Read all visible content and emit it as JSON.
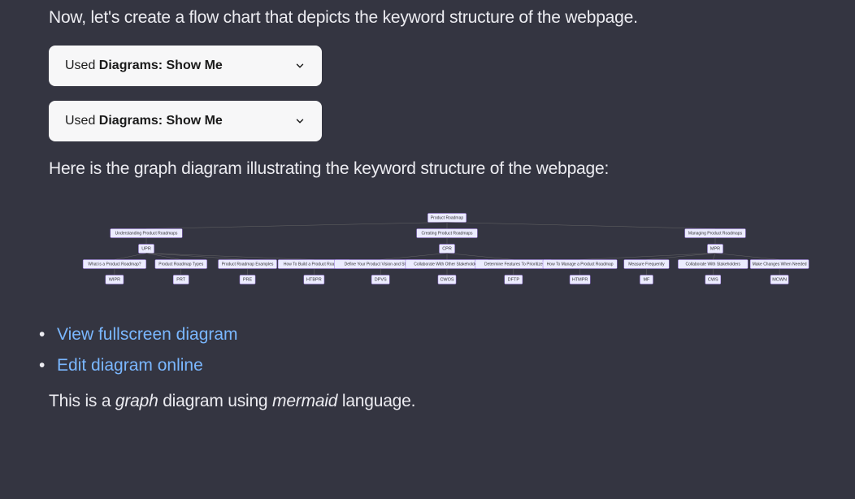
{
  "intro": "Now, let's create a flow chart that depicts the keyword structure of the webpage.",
  "accordion": {
    "prefix": "Used ",
    "bold": "Diagrams: Show Me"
  },
  "result": "Here is the graph diagram illustrating the keyword structure of the webpage:",
  "links": {
    "fullscreen": "View fullscreen diagram",
    "edit": "Edit diagram online"
  },
  "footer": {
    "p1": "This is a ",
    "em1": "graph",
    "p2": " diagram using ",
    "em2": "mermaid",
    "p3": " language."
  },
  "diagram": {
    "root": "Product Roadmap",
    "groups": [
      {
        "title": "Understanding Product Roadmaps",
        "code": "UPR"
      },
      {
        "title": "Creating Product Roadmaps",
        "code": "CPR"
      },
      {
        "title": "Managing Product Roadmaps",
        "code": "MPR"
      }
    ],
    "leaves": [
      {
        "title": "What is a Product Roadmap?",
        "code": "WIPR",
        "group": 0
      },
      {
        "title": "Product Roadmap Types",
        "code": "PRT",
        "group": 0
      },
      {
        "title": "Product Roadmap Examples",
        "code": "PRE",
        "group": 0
      },
      {
        "title": "How To Build a Product Roadmap",
        "code": "HTBPR",
        "group": 0
      },
      {
        "title": "Define Your Product Vision and Strategy",
        "code": "DPVS",
        "group": 1
      },
      {
        "title": "Collaborate With Other Stakeholders",
        "code": "CWOS",
        "group": 1
      },
      {
        "title": "Determine Features To Prioritize",
        "code": "DFTP",
        "group": 1
      },
      {
        "title": "How To Manage a Product Roadmap",
        "code": "HTMPR",
        "group": 2
      },
      {
        "title": "Measure Frequently",
        "code": "MF",
        "group": 2
      },
      {
        "title": "Collaborate With Stakeholders",
        "code": "CWS",
        "group": 2
      },
      {
        "title": "Make Changes When Needed",
        "code": "MCWN",
        "group": 2
      }
    ]
  }
}
